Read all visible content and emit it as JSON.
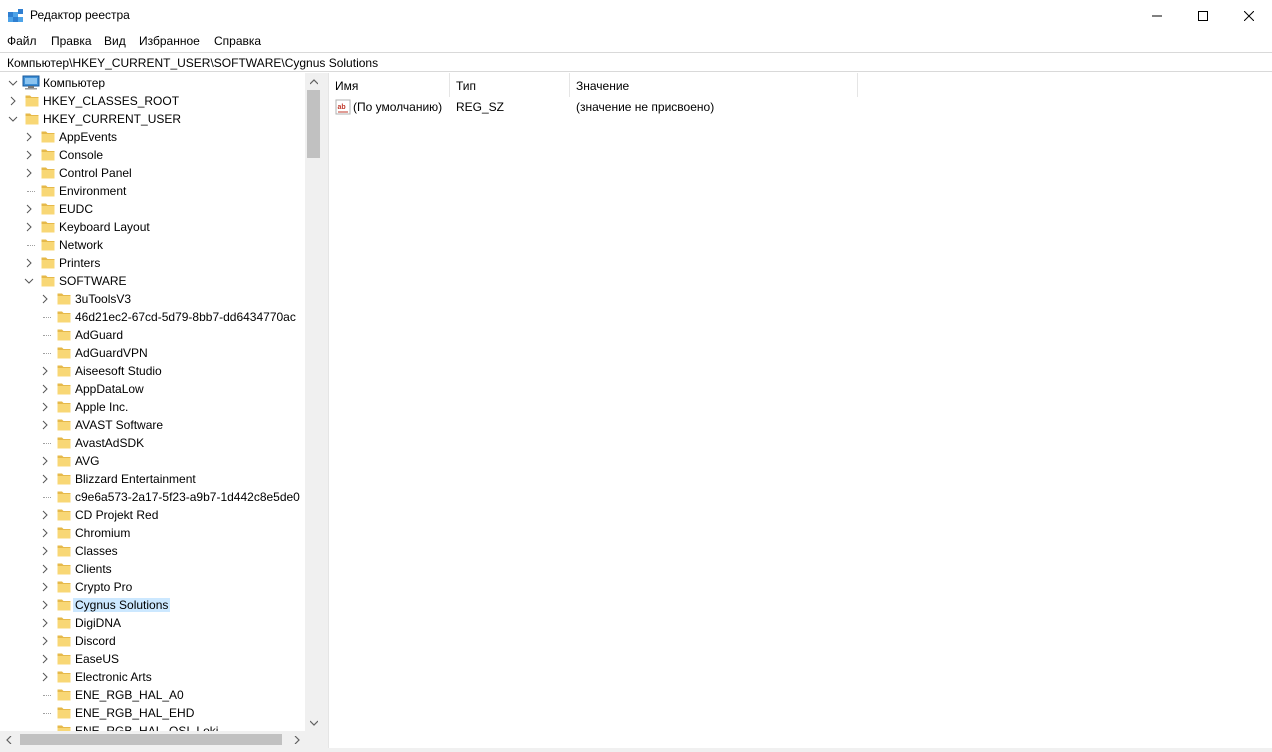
{
  "window": {
    "title": "Редактор реестра",
    "icon": "regedit-icon"
  },
  "menu": {
    "items": [
      "Файл",
      "Правка",
      "Вид",
      "Избранное",
      "Справка"
    ]
  },
  "address": {
    "path": "Компьютер\\HKEY_CURRENT_USER\\SOFTWARE\\Cygnus Solutions"
  },
  "tree": {
    "root": "Компьютер",
    "items": [
      {
        "label": "HKEY_CLASSES_ROOT",
        "level": 1,
        "expander": "collapsed"
      },
      {
        "label": "HKEY_CURRENT_USER",
        "level": 1,
        "expander": "expanded"
      },
      {
        "label": "AppEvents",
        "level": 2,
        "expander": "collapsed"
      },
      {
        "label": "Console",
        "level": 2,
        "expander": "collapsed"
      },
      {
        "label": "Control Panel",
        "level": 2,
        "expander": "collapsed"
      },
      {
        "label": "Environment",
        "level": 2,
        "expander": "none"
      },
      {
        "label": "EUDC",
        "level": 2,
        "expander": "collapsed"
      },
      {
        "label": "Keyboard Layout",
        "level": 2,
        "expander": "collapsed"
      },
      {
        "label": "Network",
        "level": 2,
        "expander": "none"
      },
      {
        "label": "Printers",
        "level": 2,
        "expander": "collapsed"
      },
      {
        "label": "SOFTWARE",
        "level": 2,
        "expander": "expanded"
      },
      {
        "label": "3uToolsV3",
        "level": 3,
        "expander": "collapsed"
      },
      {
        "label": "46d21ec2-67cd-5d79-8bb7-dd6434770ac",
        "level": 3,
        "expander": "none"
      },
      {
        "label": "AdGuard",
        "level": 3,
        "expander": "none"
      },
      {
        "label": "AdGuardVPN",
        "level": 3,
        "expander": "none"
      },
      {
        "label": "Aiseesoft Studio",
        "level": 3,
        "expander": "collapsed"
      },
      {
        "label": "AppDataLow",
        "level": 3,
        "expander": "collapsed"
      },
      {
        "label": "Apple Inc.",
        "level": 3,
        "expander": "collapsed"
      },
      {
        "label": "AVAST Software",
        "level": 3,
        "expander": "collapsed"
      },
      {
        "label": "AvastAdSDK",
        "level": 3,
        "expander": "none"
      },
      {
        "label": "AVG",
        "level": 3,
        "expander": "collapsed"
      },
      {
        "label": "Blizzard Entertainment",
        "level": 3,
        "expander": "collapsed"
      },
      {
        "label": "c9e6a573-2a17-5f23-a9b7-1d442c8e5de0",
        "level": 3,
        "expander": "none"
      },
      {
        "label": "CD Projekt Red",
        "level": 3,
        "expander": "collapsed"
      },
      {
        "label": "Chromium",
        "level": 3,
        "expander": "collapsed"
      },
      {
        "label": "Classes",
        "level": 3,
        "expander": "collapsed"
      },
      {
        "label": "Clients",
        "level": 3,
        "expander": "collapsed"
      },
      {
        "label": "Crypto Pro",
        "level": 3,
        "expander": "collapsed"
      },
      {
        "label": "Cygnus Solutions",
        "level": 3,
        "expander": "collapsed",
        "selected": true
      },
      {
        "label": "DigiDNA",
        "level": 3,
        "expander": "collapsed"
      },
      {
        "label": "Discord",
        "level": 3,
        "expander": "collapsed"
      },
      {
        "label": "EaseUS",
        "level": 3,
        "expander": "collapsed"
      },
      {
        "label": "Electronic Arts",
        "level": 3,
        "expander": "collapsed"
      },
      {
        "label": "ENE_RGB_HAL_A0",
        "level": 3,
        "expander": "none"
      },
      {
        "label": "ENE_RGB_HAL_EHD",
        "level": 3,
        "expander": "none"
      },
      {
        "label": "ENE_RGB_HAL_OSI_Loki",
        "level": 3,
        "expander": "none"
      }
    ]
  },
  "values": {
    "columns": {
      "name": "Имя",
      "type": "Тип",
      "data": "Значение"
    },
    "rows": [
      {
        "icon": "string-value-icon",
        "name": "(По умолчанию)",
        "type": "REG_SZ",
        "data": "(значение не присвоено)"
      }
    ]
  },
  "colors": {
    "selection": "#cce8ff",
    "folder": "#f8d775",
    "folder_dark": "#e6b94a",
    "scroll_track": "#f0f0f0",
    "scroll_thumb": "#c1c1c1"
  }
}
